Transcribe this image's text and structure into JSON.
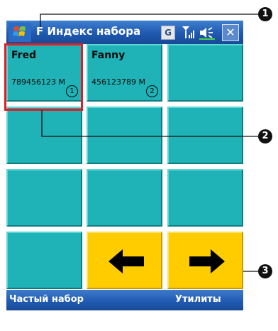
{
  "window": {
    "title": "F Индекс набора",
    "status_icons": [
      "g-icon",
      "signal-icon",
      "speaker-icon",
      "close-icon"
    ],
    "g_label": "G",
    "close_label": "✕"
  },
  "grid": {
    "contacts": [
      {
        "name": "Fred",
        "number": "789456123 M",
        "index": "1"
      },
      {
        "name": "Fanny",
        "number": "456123789 M",
        "index": "2"
      }
    ],
    "nav": {
      "prev": "arrow-left-icon",
      "next": "arrow-right-icon"
    }
  },
  "menu": {
    "left": "Частый набор",
    "right": "Утилиты"
  },
  "callouts": [
    "1",
    "2",
    "3"
  ],
  "colors": {
    "tile": "#1fb2b6",
    "nav_tile": "#ffcc00",
    "title_bar": "#1f59b0",
    "highlight": "#e11e26"
  }
}
